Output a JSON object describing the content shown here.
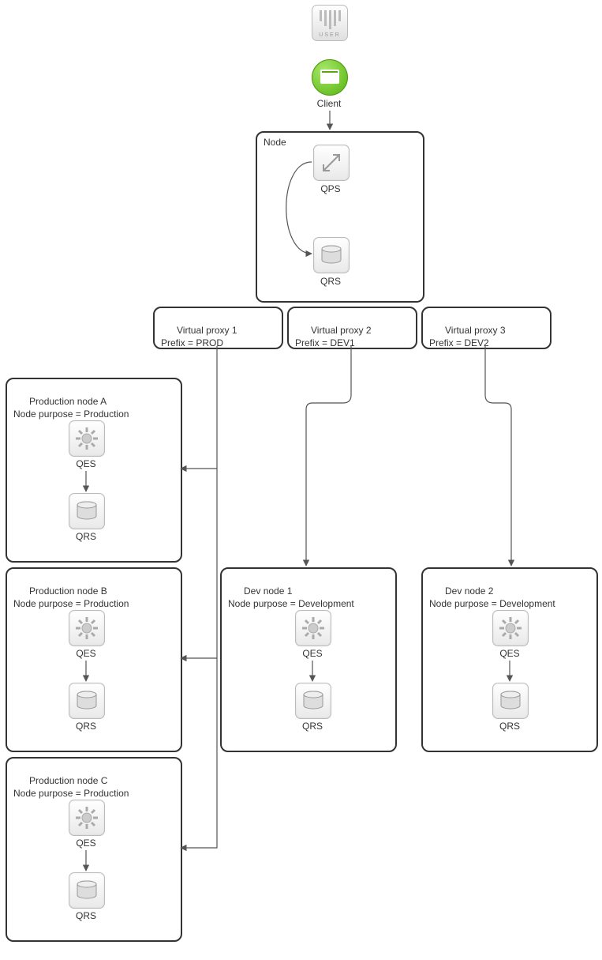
{
  "user": {
    "label": "USER"
  },
  "client": {
    "label": "Client"
  },
  "node": {
    "title": "Node",
    "qps": "QPS",
    "qrs": "QRS"
  },
  "vproxies": [
    {
      "title": "Virtual proxy 1",
      "prefix": "Prefix = PROD"
    },
    {
      "title": "Virtual proxy 2",
      "prefix": "Prefix = DEV1"
    },
    {
      "title": "Virtual proxy 3",
      "prefix": "Prefix = DEV2"
    }
  ],
  "prod_nodes": [
    {
      "title": "Production node A",
      "purpose": "Node purpose = Production",
      "qes": "QES",
      "qrs": "QRS"
    },
    {
      "title": "Production node B",
      "purpose": "Node purpose = Production",
      "qes": "QES",
      "qrs": "QRS"
    },
    {
      "title": "Production node C",
      "purpose": "Node purpose = Production",
      "qes": "QES",
      "qrs": "QRS"
    }
  ],
  "dev_nodes": [
    {
      "title": "Dev node 1",
      "purpose": "Node purpose = Development",
      "qes": "QES",
      "qrs": "QRS"
    },
    {
      "title": "Dev node 2",
      "purpose": "Node purpose = Development",
      "qes": "QES",
      "qrs": "QRS"
    }
  ]
}
